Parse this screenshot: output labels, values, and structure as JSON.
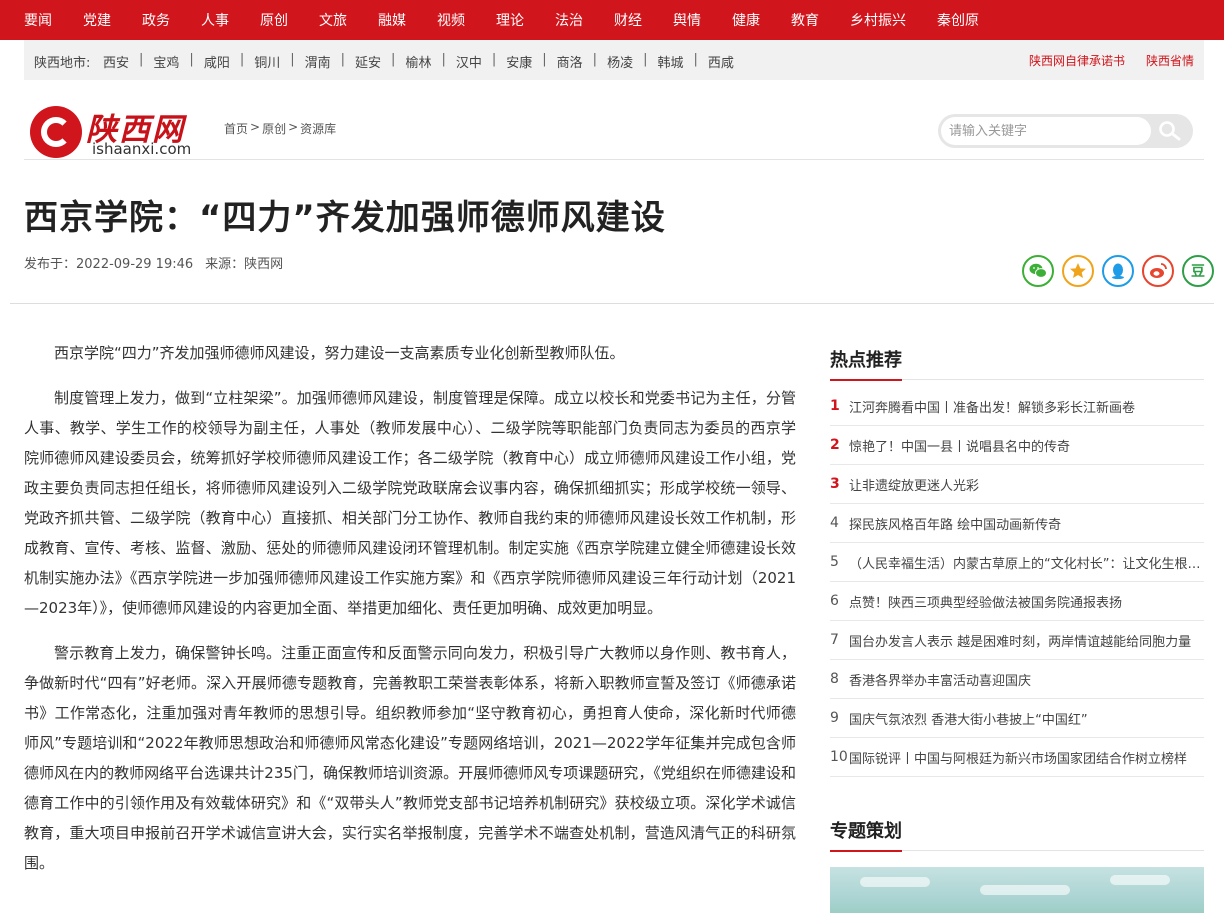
{
  "topnav": {
    "items": [
      "要闻",
      "党建",
      "政务",
      "人事",
      "原创",
      "文旅",
      "融媒",
      "视频",
      "理论",
      "法治",
      "财经",
      "舆情",
      "健康",
      "教育",
      "乡村振兴",
      "秦创原"
    ]
  },
  "regionbar": {
    "label": "陕西地市:",
    "cities": [
      "西安",
      "宝鸡",
      "咸阳",
      "铜川",
      "渭南",
      "延安",
      "榆林",
      "汉中",
      "安康",
      "商洛",
      "杨凌",
      "韩城",
      "西咸"
    ],
    "separator": "|",
    "right_links": [
      "陕西网自律承诺书",
      "陕西省情"
    ]
  },
  "header": {
    "logo_text": "陕西网",
    "logo_domain": "ishaanxi.com",
    "breadcrumb": [
      "首页",
      "原创",
      "资源库"
    ],
    "breadcrumb_sep": ">",
    "search_placeholder": "请输入关键字"
  },
  "article": {
    "title": "西京学院：“四力”齐发加强师德师风建设",
    "published": "发布于：2022-09-29 19:46",
    "source": "来源：陕西网",
    "paragraphs": [
      "西京学院“四力”齐发加强师德师风建设，努力建设一支高素质专业化创新型教师队伍。",
      "制度管理上发力，做到“立柱架梁”。加强师德师风建设，制度管理是保障。成立以校长和党委书记为主任，分管人事、教学、学生工作的校领导为副主任，人事处（教师发展中心）、二级学院等职能部门负责同志为委员的西京学院师德师风建设委员会，统筹抓好学校师德师风建设工作；各二级学院（教育中心）成立师德师风建设工作小组，党政主要负责同志担任组长，将师德师风建设列入二级学院党政联席会议事内容，确保抓细抓实；形成学校统一领导、党政齐抓共管、二级学院（教育中心）直接抓、相关部门分工协作、教师自我约束的师德师风建设长效工作机制，形成教育、宣传、考核、监督、激励、惩处的师德师风建设闭环管理机制。制定实施《西京学院建立健全师德建设长效机制实施办法》《西京学院进一步加强师德师风建设工作实施方案》和《西京学院师德师风建设三年行动计划（2021—2023年）》，使师德师风建设的内容更加全面、举措更加细化、责任更加明确、成效更加明显。",
      "警示教育上发力，确保警钟长鸣。注重正面宣传和反面警示同向发力，积极引导广大教师以身作则、教书育人，争做新时代“四有”好老师。深入开展师德专题教育，完善教职工荣誉表彰体系，将新入职教师宣誓及签订《师德承诺书》工作常态化，注重加强对青年教师的思想引导。组织教师参加“坚守教育初心，勇担育人使命，深化新时代师德师风”专题培训和“2022年教师思想政治和师德师风常态化建设”专题网络培训，2021—2022学年征集并完成包含师德师风在内的教师网络平台选课共计235门，确保教师培训资源。开展师德师风专项课题研究，《党组织在师德建设和德育工作中的引领作用及有效载体研究》和《“双带头人”教师党支部书记培养机制研究》获校级立项。深化学术诚信教育，重大项目申报前召开学术诚信宣讲大会，实行实名举报制度，完善学术不端查处机制，营造风清气正的科研氛围。"
    ]
  },
  "sidebar": {
    "hot_title": "热点推荐",
    "hot_items": [
      {
        "num": "1",
        "text": "江河奔腾看中国丨准备出发！解锁多彩长江新画卷"
      },
      {
        "num": "2",
        "text": "惊艳了！中国一县丨说唱县名中的传奇"
      },
      {
        "num": "3",
        "text": "让非遗绽放更迷人光彩"
      },
      {
        "num": "4",
        "text": "探民族风格百年路 绘中国动画新传奇"
      },
      {
        "num": "5",
        "text": "（人民幸福生活）内蒙古草原上的“文化村长”：让文化生根发芽"
      },
      {
        "num": "6",
        "text": "点赞！陕西三项典型经验做法被国务院通报表扬"
      },
      {
        "num": "7",
        "text": "国台办发言人表示 越是困难时刻，两岸情谊越能给同胞力量"
      },
      {
        "num": "8",
        "text": "香港各界举办丰富活动喜迎国庆"
      },
      {
        "num": "9",
        "text": "国庆气氛浓烈 香港大街小巷披上“中国红”"
      },
      {
        "num": "10",
        "text": "国际锐评丨中国与阿根廷为新兴市场国家团结合作树立榜样"
      }
    ],
    "topic_title": "专题策划"
  },
  "colors": {
    "brand_red": "#d0151c",
    "wechat": "#3caf36",
    "favorite": "#f0a41c",
    "qq": "#1e9ce8",
    "weibo": "#e6452f",
    "douban": "#2f9e49"
  }
}
